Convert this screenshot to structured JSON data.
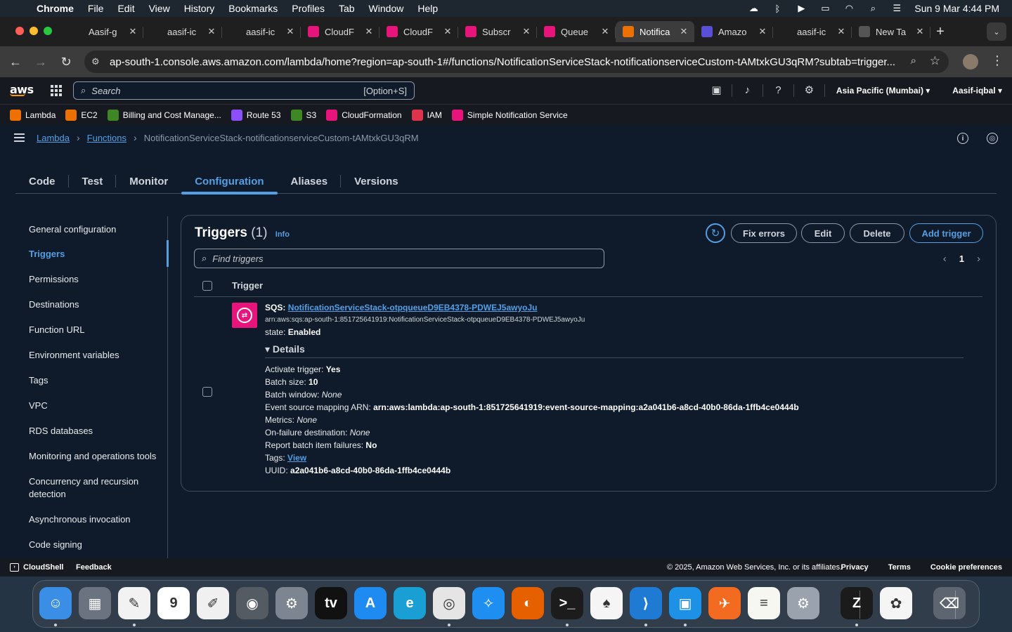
{
  "menubar": {
    "app": "Chrome",
    "items": [
      "File",
      "Edit",
      "View",
      "History",
      "Bookmarks",
      "Profiles",
      "Tab",
      "Window",
      "Help"
    ],
    "clock": "Sun 9 Mar  4:44 PM"
  },
  "tabs": [
    {
      "title": "Aasif-g",
      "icon": "github-icon",
      "color": "#1f1f1f"
    },
    {
      "title": "aasif-ic",
      "icon": "github-icon",
      "color": "#1f1f1f"
    },
    {
      "title": "aasif-ic",
      "icon": "github-icon",
      "color": "#1f1f1f"
    },
    {
      "title": "CloudF",
      "icon": "cloudformation-icon",
      "color": "#e7157b"
    },
    {
      "title": "CloudF",
      "icon": "cloudformation-icon",
      "color": "#e7157b"
    },
    {
      "title": "Subscr",
      "icon": "sns-icon",
      "color": "#e7157b"
    },
    {
      "title": "Queue",
      "icon": "sqs-icon",
      "color": "#e7157b"
    },
    {
      "title": "Notifica",
      "icon": "lambda-icon",
      "color": "#ed7100",
      "active": true
    },
    {
      "title": "Amazo",
      "icon": "cognito-icon",
      "color": "#5a4fd8"
    },
    {
      "title": "aasif-ic",
      "icon": "github-icon",
      "color": "#1f1f1f"
    },
    {
      "title": "New Ta",
      "icon": "chrome-icon",
      "color": "#555555"
    }
  ],
  "address_bar": {
    "url": "ap-south-1.console.aws.amazon.com/lambda/home?region=ap-south-1#/functions/NotificationServiceStack-notificationserviceCustom-tAMtxkGU3qRM?subtab=trigger..."
  },
  "aws_nav": {
    "logo": "aws",
    "search_placeholder": "Search",
    "search_shortcut": "[Option+S]",
    "region": "Asia Pacific (Mumbai) ▾",
    "account": "Aasif-iqbal ▾"
  },
  "favorites": [
    {
      "label": "Lambda",
      "color": "#ed7100",
      "icon": "lambda-icon"
    },
    {
      "label": "EC2",
      "color": "#ed7100",
      "icon": "ec2-icon"
    },
    {
      "label": "Billing and Cost Manage...",
      "color": "#3f8624",
      "icon": "billing-icon"
    },
    {
      "label": "Route 53",
      "color": "#8c4fff",
      "icon": "route53-icon"
    },
    {
      "label": "S3",
      "color": "#3f8624",
      "icon": "s3-icon"
    },
    {
      "label": "CloudFormation",
      "color": "#e7157b",
      "icon": "cloudformation-icon"
    },
    {
      "label": "IAM",
      "color": "#dd344c",
      "icon": "iam-icon"
    },
    {
      "label": "Simple Notification Service",
      "color": "#e7157b",
      "icon": "sns-icon"
    }
  ],
  "breadcrumb": {
    "root": "Lambda",
    "section": "Functions",
    "current": "NotificationServiceStack-notificationserviceCustom-tAMtxkGU3qRM"
  },
  "main_tabs": [
    "Code",
    "Test",
    "Monitor",
    "Configuration",
    "Aliases",
    "Versions"
  ],
  "active_tab": "Configuration",
  "side_nav": [
    "General configuration",
    "Triggers",
    "Permissions",
    "Destinations",
    "Function URL",
    "Environment variables",
    "Tags",
    "VPC",
    "RDS databases",
    "Monitoring and operations tools",
    "Concurrency and recursion detection",
    "Asynchronous invocation",
    "Code signing"
  ],
  "triggers_panel": {
    "title": "Triggers",
    "count": "(1)",
    "info": "Info",
    "buttons": {
      "fix": "Fix errors",
      "edit": "Edit",
      "delete": "Delete",
      "add": "Add trigger"
    },
    "find_placeholder": "Find triggers",
    "page": "1",
    "column": "Trigger",
    "trigger": {
      "type": "SQS:",
      "name": "NotificationServiceStack-otpqueueD9EB4378-PDWEJ5awyoJu",
      "arn": "arn:aws:sqs:ap-south-1:851725641919:NotificationServiceStack-otpqueueD9EB4378-PDWEJ5awyoJu",
      "state_label": "state:",
      "state": "Enabled",
      "details_label": "Details",
      "details": {
        "activate_label": "Activate trigger:",
        "activate": "Yes",
        "batch_size_label": "Batch size:",
        "batch_size": "10",
        "batch_window_label": "Batch window:",
        "batch_window": "None",
        "esm_label": "Event source mapping ARN:",
        "esm": "arn:aws:lambda:ap-south-1:851725641919:event-source-mapping:a2a041b6-a8cd-40b0-86da-1ffb4ce0444b",
        "metrics_label": "Metrics:",
        "metrics": "None",
        "on_failure_label": "On-failure destination:",
        "on_failure": "None",
        "report_label": "Report batch item failures:",
        "report": "No",
        "tags_label": "Tags:",
        "tags_link": "View",
        "uuid_label": "UUID:",
        "uuid": "a2a041b6-a8cd-40b0-86da-1ffb4ce0444b"
      }
    }
  },
  "footer": {
    "cloudshell": "CloudShell",
    "feedback": "Feedback",
    "copyright": "© 2025, Amazon Web Services, Inc. or its affiliates.",
    "links": [
      "Privacy",
      "Terms",
      "Cookie preferences"
    ]
  },
  "dock": [
    {
      "name": "finder-icon",
      "color": "#3a8ee6",
      "glyph": "☺"
    },
    {
      "name": "launchpad-icon",
      "color": "#6b7380",
      "glyph": "▦"
    },
    {
      "name": "easy-notepad-icon",
      "color": "#f2f2f2",
      "glyph": "✎"
    },
    {
      "name": "calendar-icon",
      "color": "#ffffff",
      "glyph": "9"
    },
    {
      "name": "textedit-icon",
      "color": "#f0f0f0",
      "glyph": "✐"
    },
    {
      "name": "screenshot-icon",
      "color": "#555b63",
      "glyph": "◉"
    },
    {
      "name": "system-settings-icon",
      "color": "#7d8590",
      "glyph": "⚙"
    },
    {
      "name": "apple-tv-icon",
      "color": "#111111",
      "glyph": "tv"
    },
    {
      "name": "app-store-icon",
      "color": "#1e8bf2",
      "glyph": "A"
    },
    {
      "name": "edge-icon",
      "color": "#1a9fd4",
      "glyph": "e"
    },
    {
      "name": "chrome-icon",
      "color": "#e5e5e5",
      "glyph": "◎"
    },
    {
      "name": "safari-icon",
      "color": "#1f8ef1",
      "glyph": "✧"
    },
    {
      "name": "firefox-icon",
      "color": "#e66000",
      "glyph": "◐"
    },
    {
      "name": "terminal-icon",
      "color": "#1c1c1c",
      "glyph": ">_"
    },
    {
      "name": "mongodb-icon",
      "color": "#f5f5f5",
      "glyph": "♠"
    },
    {
      "name": "vscode-icon",
      "color": "#1f7ad4",
      "glyph": "⟩"
    },
    {
      "name": "docker-icon",
      "color": "#1d91e6",
      "glyph": "▣"
    },
    {
      "name": "postman-icon",
      "color": "#f26b21",
      "glyph": "✈"
    },
    {
      "name": "notes-icon",
      "color": "#f7f7f2",
      "glyph": "≡"
    },
    {
      "name": "preferences-icon",
      "color": "#9aa3ad",
      "glyph": "⚙"
    },
    {
      "name": "zed-icon",
      "color": "#1b1b1b",
      "glyph": "Z"
    },
    {
      "name": "photos-icon",
      "color": "#f5f5f5",
      "glyph": "✿"
    },
    {
      "name": "trash-icon",
      "color": "#5c6570",
      "glyph": "⌫"
    }
  ]
}
